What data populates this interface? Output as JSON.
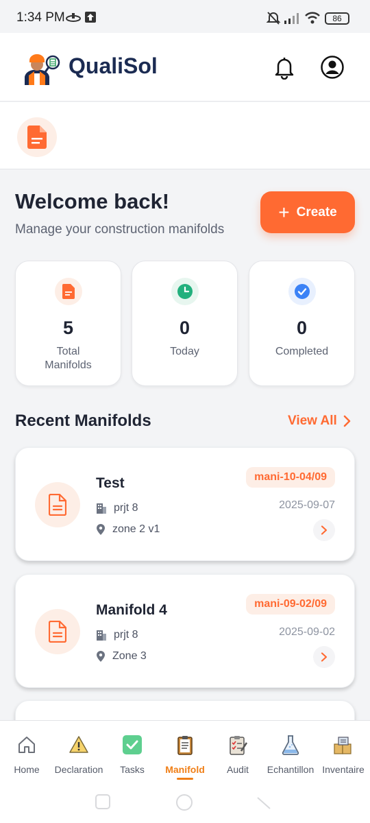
{
  "status_bar": {
    "time": "1:34 PM",
    "battery": "86"
  },
  "header": {
    "app_title": "QualiSol"
  },
  "welcome": {
    "title": "Welcome back!",
    "subtitle": "Manage your construction manifolds",
    "create_label": "Create"
  },
  "stats": [
    {
      "value": "5",
      "label": "Total Manifolds"
    },
    {
      "value": "0",
      "label": "Today"
    },
    {
      "value": "0",
      "label": "Completed"
    }
  ],
  "recent": {
    "title": "Recent Manifolds",
    "view_all": "View All",
    "items": [
      {
        "title": "Test",
        "project": "prjt 8",
        "zone": "zone 2 v1",
        "code": "mani-10-04/09",
        "date": "2025-09-07"
      },
      {
        "title": "Manifold 4",
        "project": "prjt 8",
        "zone": "Zone 3",
        "code": "mani-09-02/09",
        "date": "2025-09-02"
      }
    ]
  },
  "nav": {
    "items": [
      {
        "label": "Home",
        "icon": "home-icon"
      },
      {
        "label": "Declaration",
        "icon": "warning-icon"
      },
      {
        "label": "Tasks",
        "icon": "check-icon"
      },
      {
        "label": "Manifold",
        "icon": "clipboard-icon"
      },
      {
        "label": "Audit",
        "icon": "audit-icon"
      },
      {
        "label": "Echantillon",
        "icon": "flask-icon"
      },
      {
        "label": "Inventaire",
        "icon": "inventory-icon"
      }
    ],
    "active": "Manifold"
  },
  "colors": {
    "accent": "#ff6a32",
    "navy": "#1b2b52",
    "green": "#22b07d",
    "blue": "#3b82f6",
    "nav_active": "#f07f17"
  }
}
